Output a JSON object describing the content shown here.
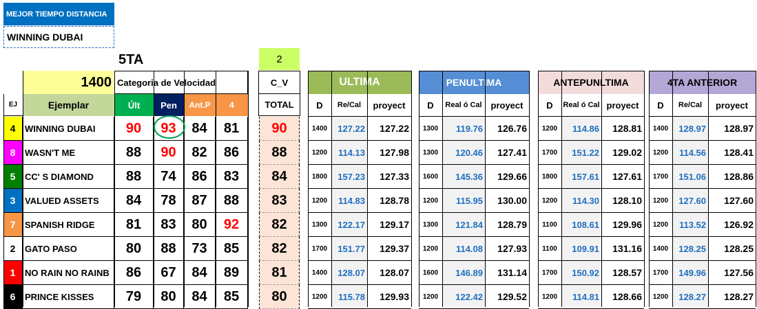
{
  "best_time": {
    "title": "MEJOR TIEMPO DISTANCIA",
    "horse": "WINNING DUBAI"
  },
  "race": {
    "label": "5TA",
    "distance": "1400",
    "category": "Categoria de Velocidad",
    "cv_value": "2",
    "cv_label": "C_V",
    "total_label": "TOTAL"
  },
  "headers": {
    "ej": "EJ",
    "ejemplar": "Ejemplar",
    "ult": "Últ",
    "pen": "Pen",
    "antp": "Ant.P",
    "cuatro": "4"
  },
  "sections": [
    {
      "title": "ULTIMA",
      "d": "D",
      "rc": "Re/Cal",
      "proy": "proyect"
    },
    {
      "title": "PENULTIMA",
      "d": "D",
      "rc": "Real ó Cal",
      "proy": "proyect"
    },
    {
      "title": "ANTEPUNLTIMA",
      "d": "D",
      "rc": "Real ó Cal",
      "proy": "proyect"
    },
    {
      "title": "4TA ANTERIOR",
      "d": "D",
      "rc": "Re/Cal",
      "proy": "proyect"
    }
  ],
  "colors": {
    "header_blue": "#0070c0",
    "yellow": "#ffff99",
    "green": "#00b050",
    "navy": "#002060",
    "orange": "#f79646",
    "total_bg": "#fce4d6",
    "cv_bg": "#ccff66",
    "ultima": "#9bbb59",
    "penultima": "#558ed5",
    "antepen": "#f2dcdb",
    "cuarta": "#b4a7d6",
    "red": "#ff0000"
  },
  "rows": [
    {
      "ej": "4",
      "ej_bg": "#ffff00",
      "ej_fg": "#000000",
      "name": "WINNING DUBAI",
      "ult": "90",
      "pen": "93",
      "antp": "84",
      "q4": "81",
      "total": "90",
      "red": [
        "ult",
        "pen"
      ],
      "circle": "pen",
      "s": [
        [
          "1400",
          "127.22",
          "127.22"
        ],
        [
          "1300",
          "119.76",
          "126.76"
        ],
        [
          "1200",
          "114.86",
          "128.81"
        ],
        [
          "1400",
          "128.97",
          "128.97"
        ]
      ]
    },
    {
      "ej": "8",
      "ej_bg": "#ff00ff",
      "ej_fg": "#ffffff",
      "name": "WASN'T ME",
      "ult": "88",
      "pen": "90",
      "antp": "82",
      "q4": "86",
      "total": "88",
      "red": [
        "pen"
      ],
      "s": [
        [
          "1200",
          "114.13",
          "127.98"
        ],
        [
          "1300",
          "120.46",
          "127.41"
        ],
        [
          "1700",
          "151.22",
          "129.02"
        ],
        [
          "1200",
          "114.56",
          "128.41"
        ]
      ]
    },
    {
      "ej": "5",
      "ej_bg": "#008000",
      "ej_fg": "#ffffff",
      "name": "CC' S DIAMOND",
      "ult": "88",
      "pen": "74",
      "antp": "86",
      "q4": "83",
      "total": "84",
      "red": [],
      "s": [
        [
          "1800",
          "157.23",
          "127.33"
        ],
        [
          "1600",
          "145.36",
          "129.66"
        ],
        [
          "1800",
          "157.61",
          "127.61"
        ],
        [
          "1700",
          "151.06",
          "128.86"
        ]
      ]
    },
    {
      "ej": "3",
      "ej_bg": "#0070c0",
      "ej_fg": "#ffffff",
      "name": "VALUED ASSETS",
      "ult": "84",
      "pen": "78",
      "antp": "87",
      "q4": "88",
      "total": "83",
      "red": [],
      "s": [
        [
          "1200",
          "114.83",
          "128.78"
        ],
        [
          "1200",
          "115.95",
          "130.00"
        ],
        [
          "1200",
          "114.30",
          "128.10"
        ],
        [
          "1200",
          "127.60",
          "127.60"
        ]
      ]
    },
    {
      "ej": "7",
      "ej_bg": "#f79646",
      "ej_fg": "#ffffff",
      "name": "SPANISH RIDGE",
      "ult": "81",
      "pen": "83",
      "antp": "80",
      "q4": "92",
      "total": "82",
      "red": [
        "q4"
      ],
      "s": [
        [
          "1300",
          "122.17",
          "129.17"
        ],
        [
          "1300",
          "121.84",
          "128.79"
        ],
        [
          "1100",
          "108.61",
          "129.96"
        ],
        [
          "1200",
          "113.52",
          "126.92"
        ]
      ]
    },
    {
      "ej": "2",
      "ej_bg": "#ffffff",
      "ej_fg": "#000000",
      "name": "GATO PASO",
      "ult": "80",
      "pen": "88",
      "antp": "73",
      "q4": "85",
      "total": "82",
      "red": [],
      "s": [
        [
          "1700",
          "151.77",
          "129.37"
        ],
        [
          "1200",
          "114.08",
          "127.93"
        ],
        [
          "1100",
          "109.91",
          "131.16"
        ],
        [
          "1400",
          "128.25",
          "128.25"
        ]
      ]
    },
    {
      "ej": "1",
      "ej_bg": "#ff0000",
      "ej_fg": "#ffffff",
      "name": "NO RAIN NO RAINB",
      "ult": "86",
      "pen": "67",
      "antp": "84",
      "q4": "89",
      "total": "81",
      "red": [],
      "s": [
        [
          "1400",
          "128.07",
          "128.07"
        ],
        [
          "1600",
          "146.89",
          "131.14"
        ],
        [
          "1700",
          "150.92",
          "128.57"
        ],
        [
          "1700",
          "149.96",
          "127.56"
        ]
      ]
    },
    {
      "ej": "6",
      "ej_bg": "#000000",
      "ej_fg": "#ffffff",
      "name": "PRINCE KISSES",
      "ult": "79",
      "pen": "80",
      "antp": "84",
      "q4": "85",
      "total": "80",
      "red": [],
      "s": [
        [
          "1200",
          "115.78",
          "129.93"
        ],
        [
          "1200",
          "122.42",
          "129.52"
        ],
        [
          "1200",
          "114.81",
          "128.66"
        ],
        [
          "1200",
          "128.27",
          "128.27"
        ]
      ]
    }
  ]
}
